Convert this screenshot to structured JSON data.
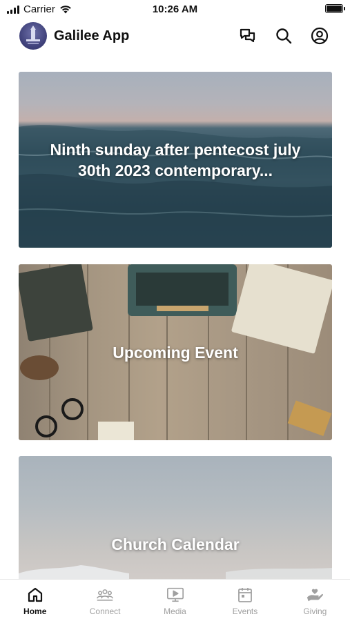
{
  "status_bar": {
    "carrier": "Carrier",
    "time": "10:26 AM"
  },
  "header": {
    "app_title": "Galilee App",
    "icons": [
      "chat-icon",
      "search-icon",
      "profile-icon"
    ]
  },
  "cards": [
    {
      "title": "Ninth sunday after pentecost july 30th 2023 contemporary..."
    },
    {
      "title": "Upcoming Event"
    },
    {
      "title": "Church Calendar"
    }
  ],
  "tab_bar": {
    "active": "Home",
    "tabs": [
      {
        "label": "Home",
        "icon": "home-icon"
      },
      {
        "label": "Connect",
        "icon": "people-icon"
      },
      {
        "label": "Media",
        "icon": "media-icon"
      },
      {
        "label": "Events",
        "icon": "calendar-icon"
      },
      {
        "label": "Giving",
        "icon": "giving-icon"
      }
    ]
  }
}
